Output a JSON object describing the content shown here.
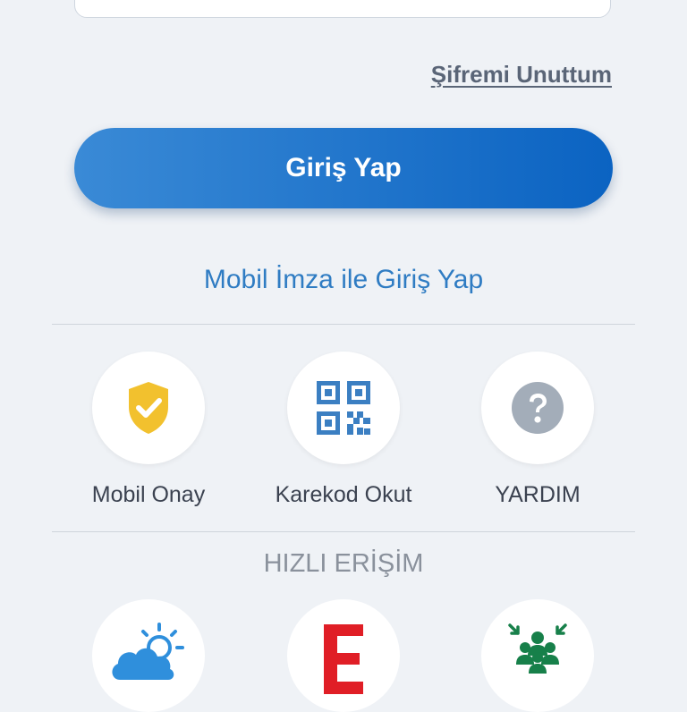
{
  "login": {
    "forgot_password": "Şifremi Unuttum",
    "submit_label": "Giriş Yap",
    "mobile_signature_label": "Mobil İmza ile Giriş Yap"
  },
  "actions": [
    {
      "label": "Mobil Onay",
      "icon": "shield-check-icon"
    },
    {
      "label": "Karekod Okut",
      "icon": "qr-code-icon"
    },
    {
      "label": "YARDIM",
      "icon": "question-circle-icon"
    }
  ],
  "quick_access": {
    "title": "HIZLI ERİŞİM",
    "items": [
      {
        "icon": "weather-icon"
      },
      {
        "icon": "e-letter-icon",
        "glyph": "E"
      },
      {
        "icon": "people-gathering-icon"
      }
    ]
  },
  "colors": {
    "primary_start": "#3a8ad6",
    "primary_end": "#0b63c2",
    "link": "#2f7cc3",
    "shield": "#f2c12e",
    "qr": "#3b7fc2",
    "help": "#a3adb9",
    "e_letter": "#e01e26",
    "gathering": "#17804a",
    "background": "#eff2f6"
  }
}
